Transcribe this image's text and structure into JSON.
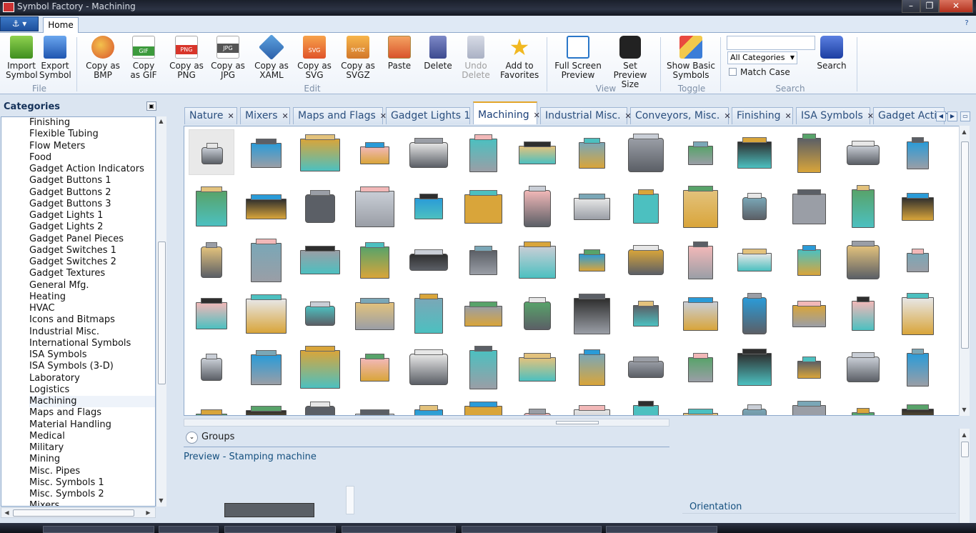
{
  "window": {
    "title": "Symbol Factory - Machining"
  },
  "ribbon": {
    "tabs": [
      {
        "label": "Home"
      }
    ],
    "buttons": {
      "import_symbol": "Import\nSymbol",
      "export_symbol": "Export\nSymbol",
      "copy_bmp": "Copy as\nBMP",
      "copy_gif": "Copy\nas GIF",
      "copy_png": "Copy as\nPNG",
      "copy_jpg": "Copy as\nJPG",
      "copy_xaml": "Copy as\nXAML",
      "copy_svg": "Copy as\nSVG",
      "copy_svgz": "Copy as\nSVGZ",
      "paste": "Paste",
      "delete": "Delete",
      "undo_delete": "Undo\nDelete",
      "add_favorites": "Add to\nFavorites",
      "full_screen": "Full Screen\nPreview",
      "set_preview": "Set\nPreview Size",
      "show_basic": "Show Basic\nSymbols",
      "search": "Search"
    },
    "icon_labels": {
      "gif": "GIF",
      "png": "PNG",
      "jpg": "JPG",
      "svg": "SVG",
      "svgz": "SVGZ"
    },
    "groups": {
      "file": "File",
      "edit": "Edit",
      "view": "View",
      "toggle": "Toggle",
      "search": "Search"
    },
    "search": {
      "query": "",
      "category_selected": "All Categories",
      "match_case_label": "Match Case",
      "match_case_checked": false
    }
  },
  "categories": {
    "header": "Categories",
    "selected": "Machining",
    "items": [
      "Finishing",
      "Flexible Tubing",
      "Flow Meters",
      "Food",
      "Gadget Action Indicators",
      "Gadget Buttons 1",
      "Gadget Buttons 2",
      "Gadget Buttons 3",
      "Gadget Lights 1",
      "Gadget Lights 2",
      "Gadget Panel Pieces",
      "Gadget Switches 1",
      "Gadget Switches 2",
      "Gadget Textures",
      "General Mfg.",
      "Heating",
      "HVAC",
      "Icons and Bitmaps",
      "Industrial Misc.",
      "International Symbols",
      "ISA Symbols",
      "ISA Symbols (3-D)",
      "Laboratory",
      "Logistics",
      "Machining",
      "Maps and Flags",
      "Material Handling",
      "Medical",
      "Military",
      "Mining",
      "Misc. Pipes",
      "Misc. Symbols 1",
      "Misc. Symbols 2",
      "Mixers"
    ]
  },
  "doc_tabs": [
    {
      "label": "Nature",
      "active": false
    },
    {
      "label": "Mixers",
      "active": false
    },
    {
      "label": "Maps and Flags",
      "active": false
    },
    {
      "label": "Gadget Lights 1",
      "active": false
    },
    {
      "label": "Machining",
      "active": true
    },
    {
      "label": "Industrial Misc.",
      "active": false
    },
    {
      "label": "Conveyors, Misc.",
      "active": false
    },
    {
      "label": "Finishing",
      "active": false
    },
    {
      "label": "ISA Symbols",
      "active": false
    },
    {
      "label": "Gadget Action",
      "active": false
    }
  ],
  "gallery": {
    "palette": [
      "#c9ced6",
      "#7aa7b7",
      "#d9a53a",
      "#58a36a",
      "#e7e7e7",
      "#5b5f66",
      "#e3c27c",
      "#2a9bd8",
      "#9a9ea6",
      "#f2b8b8",
      "#2e2e2e",
      "#4cc0c0"
    ],
    "selected_index": 0
  },
  "lower": {
    "groups_label": "Groups",
    "preview_title": "Preview - Stamping machine",
    "orientation_label": "Orientation"
  }
}
